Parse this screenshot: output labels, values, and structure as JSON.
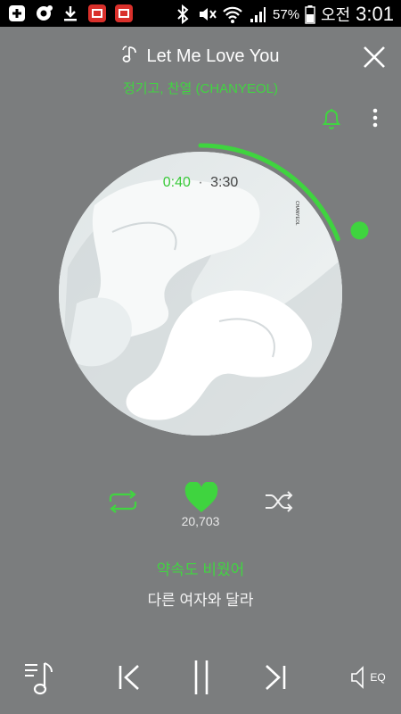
{
  "status_bar": {
    "battery_percent": "57%",
    "ampm": "오전",
    "time": "3:01"
  },
  "header": {
    "song_title": "Let Me Love You",
    "artist": "정기고, 찬열 (CHANYEOL)"
  },
  "player": {
    "current_time": "0:40",
    "separator": "·",
    "total_time": "3:30",
    "progress": 0.19,
    "album_label": "CHANYEOL",
    "like_count": "20,703",
    "liked": true
  },
  "lyrics": {
    "current": "약속도 비웠어",
    "next": "다른 여자와 달라"
  },
  "bottom_bar": {
    "eq_label": "EQ"
  },
  "colors": {
    "accent": "#41d441",
    "background": "#7b7d7e"
  },
  "icons": [
    "plus-icon",
    "settings-icon",
    "download-icon",
    "app-badge-icon",
    "bluetooth-icon",
    "mute-icon",
    "wifi-icon",
    "signal-icon",
    "battery-icon",
    "music-note-icon",
    "close-icon",
    "bell-icon",
    "more-icon",
    "repeat-icon",
    "heart-icon",
    "shuffle-icon",
    "playlist-icon",
    "previous-icon",
    "pause-icon",
    "next-icon",
    "equalizer-icon"
  ]
}
